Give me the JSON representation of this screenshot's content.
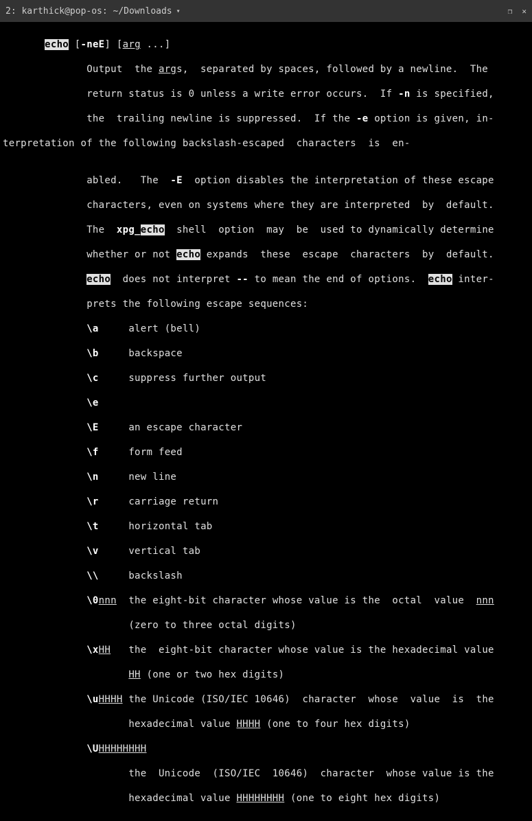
{
  "titlebar": {
    "title": "2: karthick@pop-os: ~/Downloads",
    "dropdown": "▾",
    "maximize": "❐",
    "close": "✕"
  },
  "man": {
    "cmd": "echo",
    "opt": "-neE",
    "arg": "arg",
    "ellipsis": " ...]",
    "l1a": "Output  the ",
    "l1b": "s,  separated by spaces, followed by a newline.  The",
    "l2a": "return status is 0 unless a write error occurs.  If ",
    "nopt": "-n",
    "l2b": " is specified,",
    "l3a": "the  trailing newline is suppressed.  If the ",
    "eopt": "-e",
    "l3b": " option is given, in-",
    "l4": "terpretation of the following backslash-escaped  characters  is  en-",
    "l5a": "abled.   The  ",
    "Eopt": "-E",
    "l5b": "  option disables the interpretation of these escape",
    "l6": "characters, even on systems where they are interpreted  by  default.",
    "l7a": "The  ",
    "xpg": "xpg_",
    "l7b": "  shell  option  may  be  used to dynamically determine",
    "l8a": "whether or not ",
    "l8b": " expands  these  escape  characters  by  default.",
    "l9a": "  does not interpret ",
    "dashdash": "--",
    "l9b": " to mean the end of options.  ",
    "l9c": " inter-",
    "l10": "prets the following escape sequences:",
    "seq": {
      "a": {
        "k": "\\a",
        "d": "alert (bell)"
      },
      "b": {
        "k": "\\b",
        "d": "backspace"
      },
      "c": {
        "k": "\\c",
        "d": "suppress further output"
      },
      "e": {
        "k": "\\e"
      },
      "E": {
        "k": "\\E",
        "d": "an escape character"
      },
      "f": {
        "k": "\\f",
        "d": "form feed"
      },
      "n": {
        "k": "\\n",
        "d": "new line"
      },
      "r": {
        "k": "\\r",
        "d": "carriage return"
      },
      "t": {
        "k": "\\t",
        "d": "horizontal tab"
      },
      "v": {
        "k": "\\v",
        "d": "vertical tab"
      },
      "bs": {
        "k": "\\\\",
        "d": "backslash"
      },
      "zero": {
        "k": "\\0",
        "u": "nnn",
        "d1": "the eight-bit character whose value is the  octal  value  ",
        "d2": "(zero to three octal digits)"
      },
      "x": {
        "k": "\\x",
        "u": "HH",
        "d1": "the  eight-bit character whose value is the hexadecimal value",
        "d2": " (one or two hex digits)"
      },
      "uu": {
        "k": "\\u",
        "u": "HHHH",
        "d1": "the Unicode (ISO/IEC 10646)  character  whose  value  is  the",
        "d2": "hexadecimal value ",
        "d3": " (one to four hex digits)"
      },
      "UU": {
        "k": "\\U",
        "u": "HHHHHHHH",
        "d1": "the  Unicode  (ISO/IEC  10646)  character  whose value is the",
        "d2": "hexadecimal value ",
        "d3": " (one to eight hex digits)"
      }
    }
  }
}
